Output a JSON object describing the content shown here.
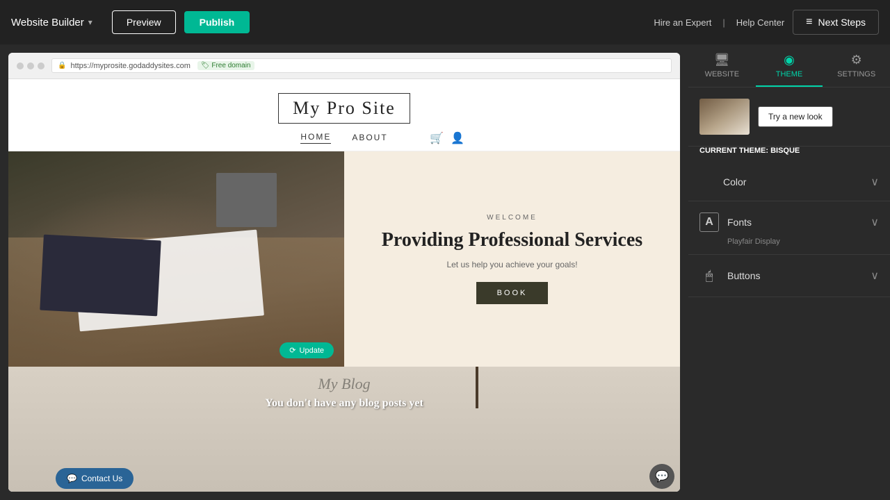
{
  "topbar": {
    "brand_label": "Website Builder",
    "chevron": "▾",
    "preview_label": "Preview",
    "publish_label": "Publish",
    "hire_expert": "Hire an Expert",
    "separator": "|",
    "help_center": "Help Center",
    "next_steps_label": "Next Steps",
    "next_steps_icon": "≡"
  },
  "browser": {
    "url": "https://myprosite.godaddysites.com",
    "free_domain": "🏷 Free domain"
  },
  "site": {
    "title": "My Pro Site",
    "nav": [
      {
        "label": "HOME",
        "active": true
      },
      {
        "label": "ABOUT",
        "active": false
      }
    ],
    "hero": {
      "welcome": "WELCOME",
      "heading": "Providing Professional Services",
      "subtext": "Let us help you achieve your goals!",
      "book_btn": "BOOK",
      "update_btn": "Update"
    },
    "blog": {
      "title": "My Blog",
      "no_posts": "You don't have any blog posts yet"
    }
  },
  "contact_btn": "Contact Us",
  "panel": {
    "tabs": [
      {
        "label": "WEBSITE",
        "icon": "🖥",
        "active": false
      },
      {
        "label": "THEME",
        "icon": "◉",
        "active": true
      },
      {
        "label": "SETTINGS",
        "icon": "⚙",
        "active": false
      }
    ],
    "current_theme_prefix": "CURRENT THEME:",
    "current_theme_name": "BISQUE",
    "try_new_look": "Try a new look",
    "sections": [
      {
        "id": "color",
        "label": "Color",
        "icon": "color-grid",
        "sublabel": null
      },
      {
        "id": "fonts",
        "label": "Fonts",
        "icon": "A",
        "sublabel": "Playfair Display"
      },
      {
        "id": "buttons",
        "label": "Buttons",
        "icon": "🖱",
        "sublabel": null
      }
    ],
    "color_cells": [
      "#e74c3c",
      "#3498db",
      "#2ecc71",
      "#f39c12"
    ]
  }
}
